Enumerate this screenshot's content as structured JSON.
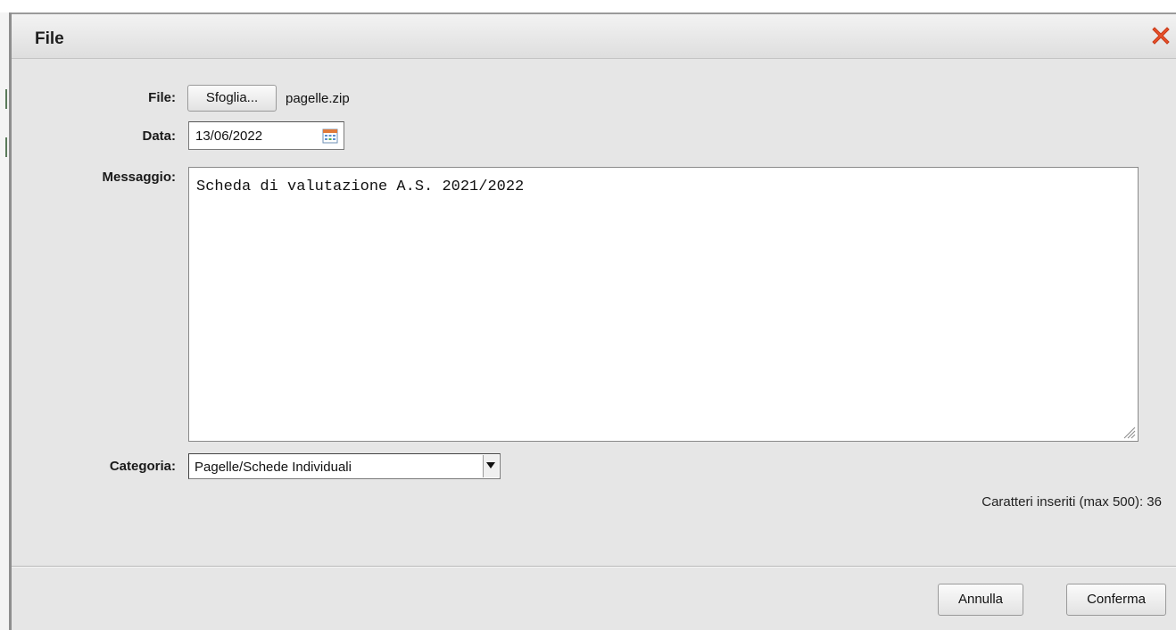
{
  "dialog": {
    "title": "File",
    "close_icon": "close-x-icon",
    "close_color": "#e8502a"
  },
  "form": {
    "file": {
      "label": "File:",
      "browse_label": "Sfoglia...",
      "filename": "pagelle.zip"
    },
    "date": {
      "label": "Data:",
      "value": "13/06/2022",
      "icon": "calendar-icon"
    },
    "message": {
      "label": "Messaggio:",
      "value": "Scheda di valutazione A.S. 2021/2022"
    },
    "category": {
      "label": "Categoria:",
      "selected": "Pagelle/Schede Individuali"
    },
    "char_count": "Caratteri inseriti (max 500): 36"
  },
  "footer": {
    "cancel_label": "Annulla",
    "confirm_label": "Conferma"
  }
}
